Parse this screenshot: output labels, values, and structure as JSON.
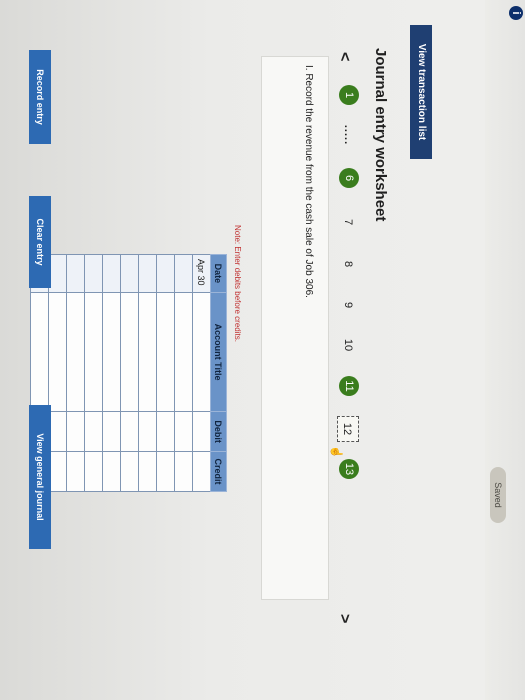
{
  "header": {
    "info_icon": "i",
    "saved_label": "Saved"
  },
  "view_transaction_list_label": "View transaction list",
  "worksheet_title": "Journal entry worksheet",
  "navigation": {
    "prev_glyph": "<",
    "next_glyph": ">",
    "tabs": [
      {
        "label": "1",
        "state": "done"
      },
      {
        "label": ".....",
        "state": "ellipsis"
      },
      {
        "label": "6",
        "state": "done"
      },
      {
        "label": "7",
        "state": "plain"
      },
      {
        "label": "8",
        "state": "plain"
      },
      {
        "label": "9",
        "state": "plain"
      },
      {
        "label": "10",
        "state": "plain"
      },
      {
        "label": "11",
        "state": "done"
      },
      {
        "label": "12",
        "state": "current"
      },
      {
        "label": "13",
        "state": "done"
      }
    ]
  },
  "instruction": "I. Record the revenue from the cash sale of Job 306.",
  "note": "Note: Enter debits before credits.",
  "table": {
    "headers": {
      "date": "Date",
      "account": "Account Title",
      "debit": "Debit",
      "credit": "Credit"
    },
    "first_date": "Apr 30",
    "row_count": 10
  },
  "buttons": {
    "record": "Record entry",
    "clear": "Clear entry",
    "view_journal": "View general journal"
  },
  "colors": {
    "nav_done": "#3a7d1d",
    "primary_button": "#2d6ab3",
    "header_button": "#1f3f72",
    "table_header": "#6a93c8",
    "note_text": "#c03030"
  }
}
